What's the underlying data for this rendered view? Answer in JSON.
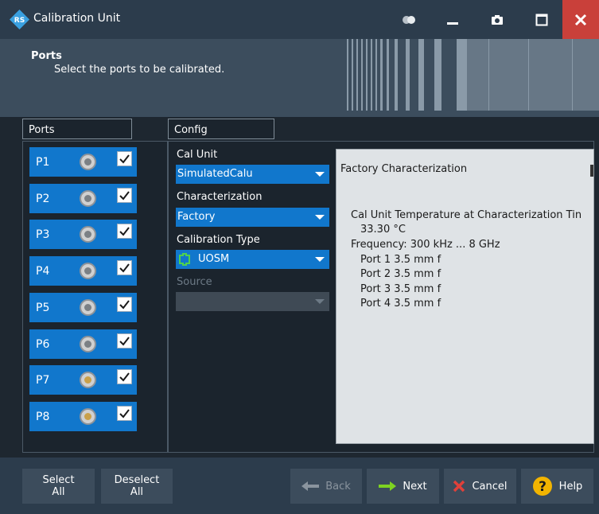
{
  "window": {
    "title": "Calibration Unit"
  },
  "header": {
    "title": "Ports",
    "description": "Select the ports to be calibrated."
  },
  "sections": {
    "ports": "Ports",
    "config": "Config"
  },
  "ports": [
    {
      "label": "P1",
      "checked": true,
      "connector": "silver"
    },
    {
      "label": "P2",
      "checked": true,
      "connector": "silver"
    },
    {
      "label": "P3",
      "checked": true,
      "connector": "silver"
    },
    {
      "label": "P4",
      "checked": true,
      "connector": "silver"
    },
    {
      "label": "P5",
      "checked": true,
      "connector": "silver"
    },
    {
      "label": "P6",
      "checked": true,
      "connector": "silver"
    },
    {
      "label": "P7",
      "checked": true,
      "connector": "gold"
    },
    {
      "label": "P8",
      "checked": true,
      "connector": "gold"
    }
  ],
  "config": {
    "cal_unit_label": "Cal Unit",
    "cal_unit_value": "SimulatedCalu",
    "characterization_label": "Characterization",
    "characterization_value": "Factory",
    "calibration_type_label": "Calibration Type",
    "calibration_type_value": "UOSM",
    "source_label": "Source",
    "source_value": ""
  },
  "info": {
    "lines": [
      "Factory Characterization",
      "Cal Unit Temperature at Characterization Tin",
      "33.30 °C",
      "Frequency: 300 kHz ... 8 GHz",
      "Port 1 3.5 mm f",
      "Port 2 3.5 mm f",
      "Port 3 3.5 mm f",
      "Port 4 3.5 mm f"
    ]
  },
  "footer": {
    "select_all": [
      "Select",
      "All"
    ],
    "deselect_all": [
      "Deselect",
      "All"
    ],
    "back": "Back",
    "next": "Next",
    "cancel": "Cancel",
    "help": "Help"
  },
  "colors": {
    "port_blue": "#1177cc",
    "close_red": "#c9403a",
    "next_arrow": "#7ed321",
    "cancel_x": "#e0403a",
    "help_yellow": "#f2b400"
  }
}
